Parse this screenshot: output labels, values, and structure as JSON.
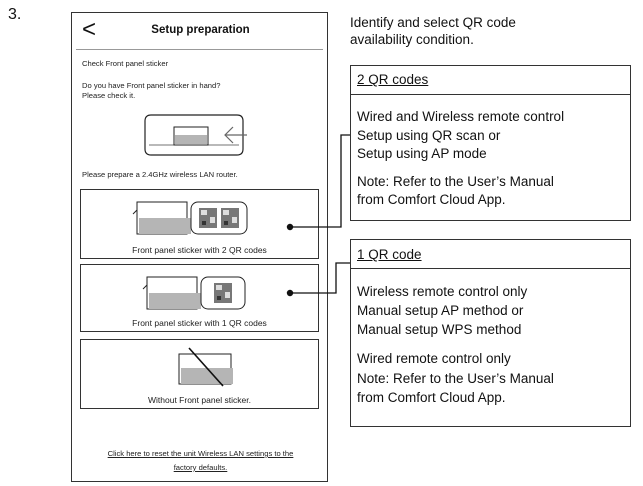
{
  "step_number": "3.",
  "phone": {
    "back_glyph": "<",
    "title": "Setup preparation",
    "check_label": "Check Front panel sticker",
    "question_line1": "Do you have Front panel sticker in hand?",
    "question_line2": "Please check it.",
    "router_note": "Please prepare a 2.4GHz wireless LAN router.",
    "options": [
      {
        "label": "Front panel sticker with 2 QR codes"
      },
      {
        "label": "Front panel sticker with 1 QR codes"
      },
      {
        "label": "Without Front panel sticker."
      }
    ],
    "reset_line1": "Click here to reset the unit Wireless LAN settings to the",
    "reset_line2": "factory defaults."
  },
  "instruction": {
    "line1": "Identify and select QR code",
    "line2": "availability condition."
  },
  "box_two": {
    "heading": "2 QR codes",
    "line1": "Wired and Wireless remote control",
    "line2": "Setup using QR scan or",
    "line3": "Setup using AP mode",
    "note1": "Note: Refer to the User’s Manual",
    "note2": "from Comfort Cloud App."
  },
  "box_one": {
    "heading": "1 QR code",
    "line1": "Wireless remote control only",
    "line2": "Manual setup AP method or",
    "line3": "Manual setup WPS method",
    "line4": "Wired remote control only",
    "note1": "Note: Refer to the User’s Manual",
    "note2": "from Comfort Cloud App."
  }
}
